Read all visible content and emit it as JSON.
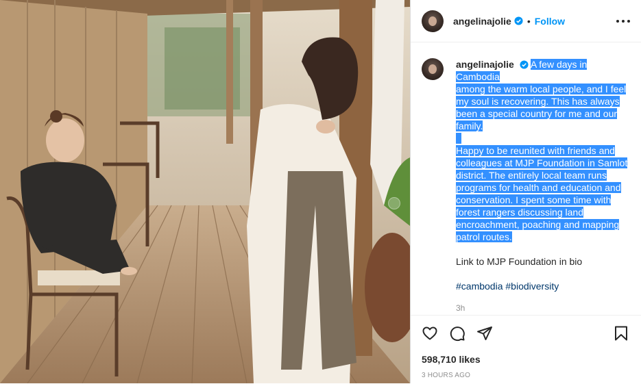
{
  "post": {
    "username": "angelinajolie",
    "dot": "•",
    "follow_label": "Follow",
    "caption": {
      "lines_highlighted": [
        "A few days in Cambodia",
        "among the warm local people, and I feel",
        "my soul is recovering. This has always",
        "been a special country for me and our",
        "family."
      ],
      "lines_highlighted_2": [
        "Happy to be reunited with friends and",
        "colleagues at MJP Foundation in Samlot",
        "district. The entirely local team runs",
        "programs for health and education and",
        "conservation. I spent some time with",
        "forest rangers discussing land",
        "encroachment, poaching and mapping",
        "patrol routes."
      ],
      "link_line": "Link to MJP Foundation in bio",
      "hashtags": [
        "#cambodia",
        "#biodiversity"
      ],
      "relative_time": "3h"
    },
    "likes": "598,710 likes",
    "posted_ago": "3 HOURS AGO"
  },
  "icons": {
    "verified": "verified-badge-icon",
    "more": "more-options-icon",
    "like": "heart-icon",
    "comment": "comment-icon",
    "share": "share-icon",
    "save": "bookmark-icon"
  },
  "colors": {
    "accent": "#0095f6",
    "highlight": "#3390ff",
    "hashtag": "#00376b",
    "muted": "#8e8e8e"
  }
}
